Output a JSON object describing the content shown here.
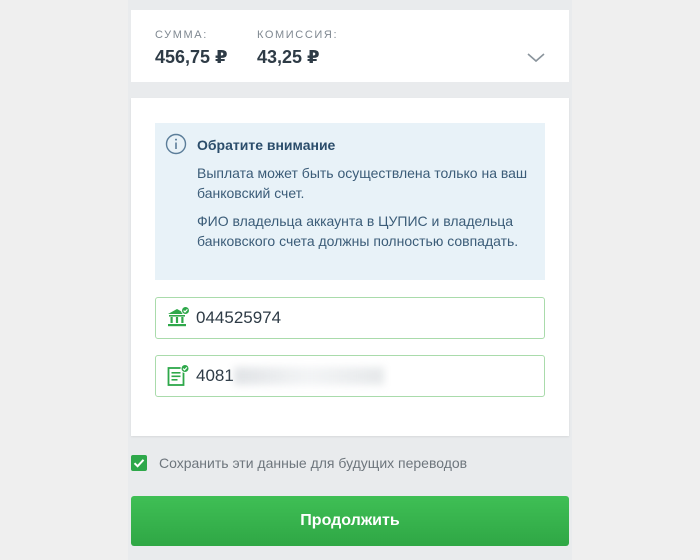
{
  "summary": {
    "amount_label": "СУММА:",
    "amount_value": "456,75 ₽",
    "commission_label": "КОМИССИЯ:",
    "commission_value": "43,25 ₽",
    "expand_icon": "chevron-down-icon"
  },
  "notice": {
    "icon": "info-icon",
    "title": "Обратите внимание",
    "line1": "Выплата может быть осуществлена только на ваш банковский счет.",
    "line2": "ФИО владельца аккаунта в ЦУПИС и владельца банковского счета должны полностью совпадать."
  },
  "fields": {
    "bik": {
      "icon": "bank-icon",
      "value": "044525974"
    },
    "account": {
      "icon": "document-icon",
      "value": "4081"
    }
  },
  "save_data": {
    "checked": true,
    "label": "Сохранить эти данные для будущих переводов"
  },
  "continue_button": {
    "label": "Продолжить"
  },
  "colors": {
    "accent_green": "#2ea84a",
    "notice_bg": "#e8f2f8",
    "field_border": "#a9dbab"
  }
}
